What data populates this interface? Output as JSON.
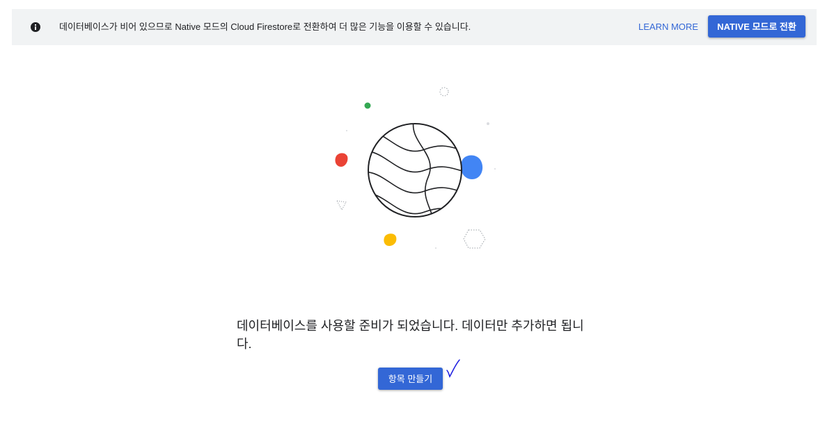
{
  "banner": {
    "icon": "info-icon",
    "message": "데이터베이스가 비어 있으므로 Native 모드의 Cloud Firestore로 전환하여 더 많은 기능을 이용할 수 있습니다.",
    "learn_more_label": "LEARN MORE",
    "switch_button_label": "NATIVE 모드로 전환"
  },
  "main": {
    "illustration": "globe-illustration",
    "empty_message": "데이터베이스를 사용할 준비가 되었습니다. 데이터만 추가하면 됩니다.",
    "create_button_label": "항목 만들기",
    "annotation": "check-mark-annotation"
  },
  "colors": {
    "accent": "#3367d6",
    "banner_bg": "#f1f3f4",
    "dot_green": "#34a853",
    "dot_red": "#ea4335",
    "dot_blue": "#4285f4",
    "dot_yellow": "#fbbc04",
    "check_mark": "#1a1ae0"
  }
}
